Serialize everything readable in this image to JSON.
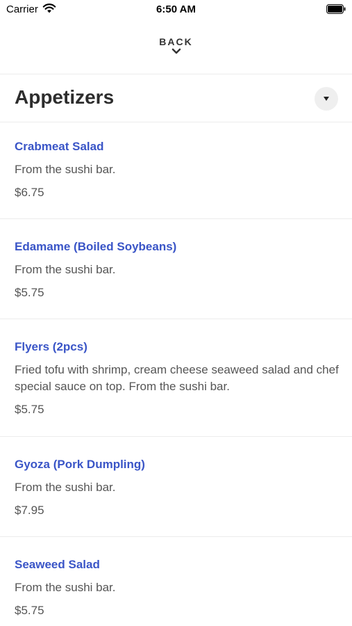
{
  "status_bar": {
    "carrier": "Carrier",
    "time": "6:50 AM"
  },
  "nav": {
    "back_label": "BACK"
  },
  "section": {
    "title": "Appetizers"
  },
  "items": [
    {
      "name": "Crabmeat Salad",
      "description": "From the sushi bar.",
      "price": "$6.75"
    },
    {
      "name": "Edamame (Boiled Soybeans)",
      "description": "From the sushi bar.",
      "price": "$5.75"
    },
    {
      "name": "Flyers (2pcs)",
      "description": "Fried tofu with shrimp, cream cheese seaweed salad and chef special sauce on top. From the sushi bar.",
      "price": "$5.75"
    },
    {
      "name": "Gyoza (Pork Dumpling)",
      "description": "From the sushi bar.",
      "price": "$7.95"
    },
    {
      "name": "Seaweed Salad",
      "description": "From the sushi bar.",
      "price": "$5.75"
    }
  ],
  "colors": {
    "item_name": "#3a55c7",
    "text_secondary": "#555555",
    "divider": "#ececec"
  }
}
